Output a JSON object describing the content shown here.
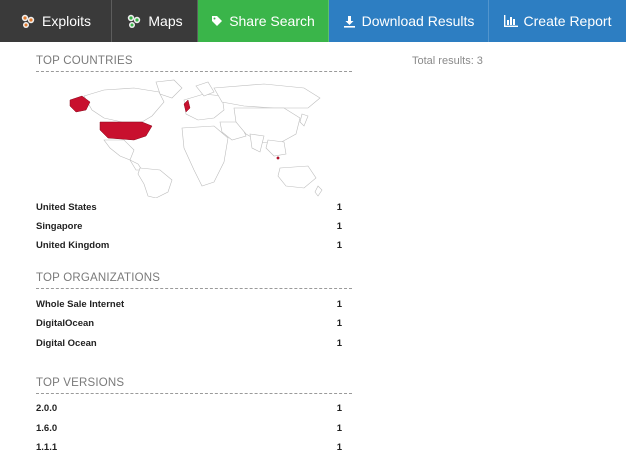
{
  "toolbar": {
    "exploits_label": "Exploits",
    "maps_label": "Maps",
    "share_label": "Share Search",
    "download_label": "Download Results",
    "report_label": "Create Report"
  },
  "summary": {
    "total_label": "Total results: 3"
  },
  "countries": {
    "title": "TOP COUNTRIES",
    "rows": [
      {
        "name": "United States",
        "count": "1"
      },
      {
        "name": "Singapore",
        "count": "1"
      },
      {
        "name": "United Kingdom",
        "count": "1"
      }
    ]
  },
  "organizations": {
    "title": "TOP ORGANIZATIONS",
    "rows": [
      {
        "name": "Whole Sale Internet",
        "count": "1"
      },
      {
        "name": "DigitalOcean",
        "count": "1"
      },
      {
        "name": "Digital Ocean",
        "count": "1"
      }
    ]
  },
  "versions": {
    "title": "TOP VERSIONS",
    "rows": [
      {
        "name": "2.0.0",
        "count": "1"
      },
      {
        "name": "1.6.0",
        "count": "1"
      },
      {
        "name": "1.1.1",
        "count": "1"
      }
    ]
  },
  "colors": {
    "toolbar_dark": "#3a3a3a",
    "share_green": "#3ab54a",
    "action_blue": "#2d7ec2",
    "map_highlight": "#c8102e"
  }
}
